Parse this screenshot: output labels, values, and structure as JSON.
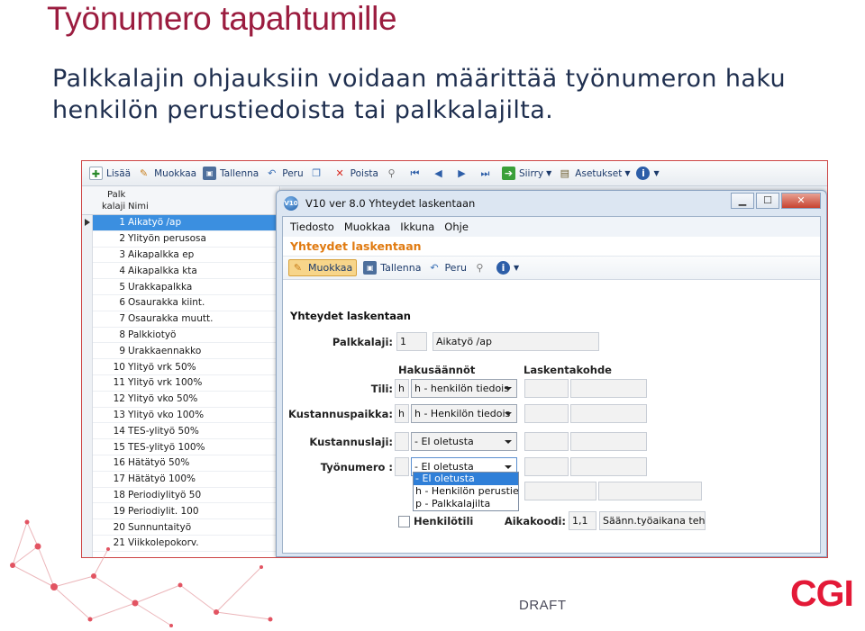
{
  "slide": {
    "title": "Työnumero tapahtumille",
    "body_line1": "Palkkalajin ohjauksiin voidaan määrittää työnumeron haku",
    "body_line2": "henkilön perustiedoista tai palkkalajilta.",
    "footer": "DRAFT",
    "logo": "CGI"
  },
  "main_toolbar": {
    "add": "Lisää",
    "edit": "Muokkaa",
    "save": "Tallenna",
    "cancel": "Peru",
    "delete": "Poista",
    "move": "Siirry",
    "settings": "Asetukset"
  },
  "grid": {
    "header_palk": "Palk",
    "header_kalaji": "kalaji",
    "header_nimi": "Nimi",
    "rows": [
      {
        "num": "1",
        "name": "Aikatyö /ap"
      },
      {
        "num": "2",
        "name": "Ylityön perusosa"
      },
      {
        "num": "3",
        "name": "Aikapalkka ep"
      },
      {
        "num": "4",
        "name": "Aikapalkka kta"
      },
      {
        "num": "5",
        "name": "Urakkapalkka"
      },
      {
        "num": "6",
        "name": "Osaurakka kiint."
      },
      {
        "num": "7",
        "name": "Osaurakka muutt."
      },
      {
        "num": "8",
        "name": "Palkkiotyö"
      },
      {
        "num": "9",
        "name": "Urakkaennakko"
      },
      {
        "num": "10",
        "name": "Ylityö vrk 50%"
      },
      {
        "num": "11",
        "name": "Ylityö vrk 100%"
      },
      {
        "num": "12",
        "name": "Ylityö vko 50%"
      },
      {
        "num": "13",
        "name": "Ylityö vko 100%"
      },
      {
        "num": "14",
        "name": "TES-ylityö 50%"
      },
      {
        "num": "15",
        "name": "TES-ylityö 100%"
      },
      {
        "num": "16",
        "name": "Hätätyö 50%"
      },
      {
        "num": "17",
        "name": "Hätätyö 100%"
      },
      {
        "num": "18",
        "name": "Periodiylityö 50"
      },
      {
        "num": "19",
        "name": "Periodiylit. 100"
      },
      {
        "num": "20",
        "name": "Sunnuntaityö"
      },
      {
        "num": "21",
        "name": "Viikkolepokorv."
      }
    ]
  },
  "dialog": {
    "window_title": "V10 ver 8.0 Yhteydet laskentaan",
    "menu": [
      "Tiedosto",
      "Muokkaa",
      "Ikkuna",
      "Ohje"
    ],
    "heading": "Yhteydet laskentaan",
    "toolbar_edit": "Muokkaa",
    "toolbar_save": "Tallenna",
    "toolbar_cancel": "Peru",
    "section": "Yhteydet laskentaan",
    "palkkalaji_label": "Palkkalaji:",
    "palkkalaji_code": "1",
    "palkkalaji_name": "Aikatyö /ap",
    "col_hakusaannot": "Hakusäännöt",
    "col_laskentakohde": "Laskentakohde",
    "tili_label": "Tili:",
    "tili_code": "h",
    "tili_combo": "h - henkilön tiedois",
    "kustannuspaikka_label": "Kustannuspaikka:",
    "kustannuspaikka_code": "h",
    "kustannuspaikka_combo": "h - Henkilön tiedois",
    "kustannuslaji_label": "Kustannuslaji:",
    "kustannuslaji_combo": "- EI oletusta",
    "tyonumero_label": "Työnumero :",
    "tyonumero_combo": "- EI oletusta",
    "dropdown_options": [
      "- EI oletusta",
      "h - Henkilön perustiedo",
      "p - Palkkalajilta"
    ],
    "henkilotili_label": "Henkilötili",
    "aikakoodi_label": "Aikakoodi:",
    "aikakoodi_code": "1,1",
    "aikakoodi_name": "Säänn.työaikana tehty"
  }
}
